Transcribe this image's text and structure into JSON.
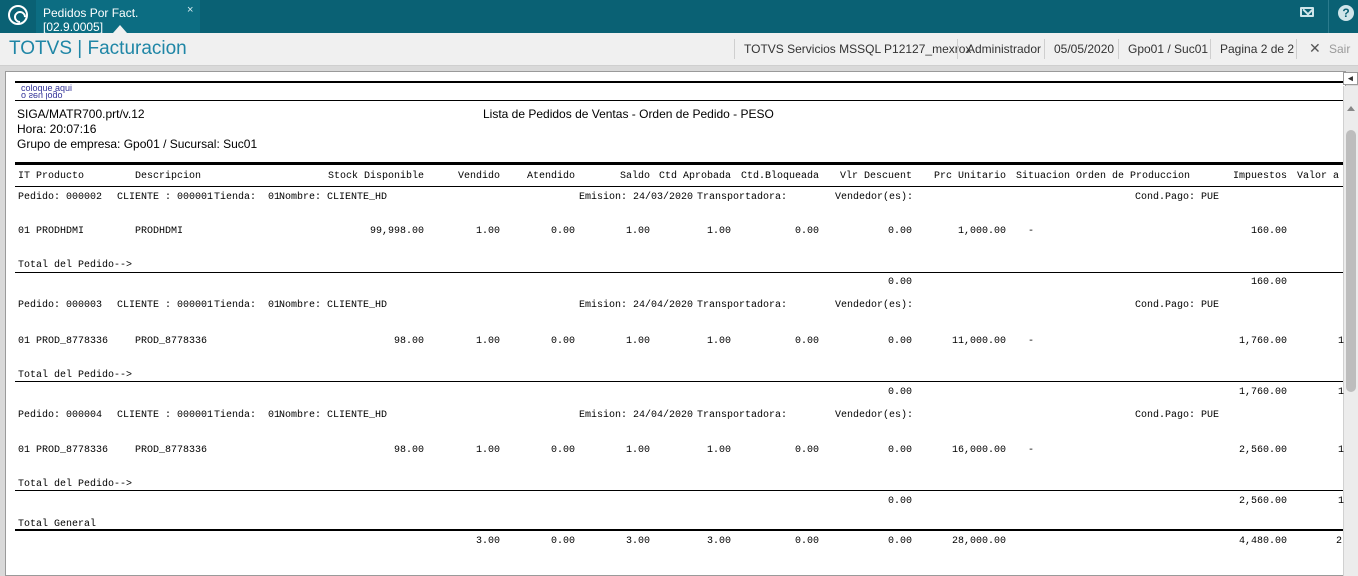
{
  "topbar": {
    "tab_title": "Pedidos Por Fact. [02.9.0005]",
    "tab_close": "×",
    "help": "?"
  },
  "titlebar": {
    "app_title": "TOTVS | Facturacion",
    "server": "TOTVS Servicios MSSQL P12127_mexrox",
    "user": "Administrador",
    "date": "05/05/2020",
    "branch": "Gpo01 / Suc01",
    "page": "Pagina 2 de 2",
    "exit_icon": "✕",
    "exit_label": "Sair"
  },
  "viewer": {
    "collapse": "◂",
    "logo_line1": "coloque aqui",
    "logo_line2": "o seu logo"
  },
  "report": {
    "program": "SIGA/MATR700.prt/v.12",
    "title": "Lista de Pedidos de Ventas  - Orden de Pedido - PESO",
    "time": "Hora: 20:07:16",
    "group": "Grupo de empresa: Gpo01 / Sucursal: Suc01",
    "columns": {
      "it_producto": "IT Producto",
      "descripcion": "Descripcion",
      "stock": "Stock Disponible",
      "vendido": "Vendido",
      "atendido": "Atendido",
      "saldo": "Saldo",
      "ctd_aprobada": "Ctd Aprobada",
      "ctd_bloqueada": "Ctd.Bloqueada",
      "vlr_descuent": "Vlr Descuent",
      "prc_unitario": "Prc Unitario",
      "situacion": "Situacion",
      "orden_produccion": "Orden de Produccion",
      "impuestos": "Impuestos",
      "valor": "Valor a"
    },
    "orders": [
      {
        "pedido": "Pedido: 000002",
        "cliente": "CLIENTE : 000001",
        "tienda": "Tienda:  01",
        "nombre": "Nombre: CLIENTE_HD",
        "emision": "Emision: 24/03/2020",
        "transportadora": "Transportadora:",
        "vendedor": "Vendedor(es):",
        "cond_pago": "Cond.Pago: PUE",
        "item": {
          "it_producto": "01 PRODHDMI",
          "descripcion": "PRODHDMI",
          "stock": "99,998.00",
          "vendido": "1.00",
          "atendido": "0.00",
          "saldo": "1.00",
          "ctd_aprobada": "1.00",
          "ctd_bloqueada": "0.00",
          "vlr_descuent": "0.00",
          "prc_unitario": "1,000.00",
          "situacion": "-",
          "impuestos": "160.00",
          "valor": ""
        },
        "total_label": "Total del Pedido-->",
        "total_descuent": "0.00",
        "total_impuestos": "160.00",
        "total_valor": ""
      },
      {
        "pedido": "Pedido: 000003",
        "cliente": "CLIENTE : 000001",
        "tienda": "Tienda:  01",
        "nombre": "Nombre: CLIENTE_HD",
        "emision": "Emision: 24/04/2020",
        "transportadora": "Transportadora:",
        "vendedor": "Vendedor(es):",
        "cond_pago": "Cond.Pago: PUE",
        "item": {
          "it_producto": "01 PROD_8778336",
          "descripcion": "PROD_8778336",
          "stock": "98.00",
          "vendido": "1.00",
          "atendido": "0.00",
          "saldo": "1.00",
          "ctd_aprobada": "1.00",
          "ctd_bloqueada": "0.00",
          "vlr_descuent": "0.00",
          "prc_unitario": "11,000.00",
          "situacion": "-",
          "impuestos": "1,760.00",
          "valor": "1"
        },
        "total_label": "Total del Pedido-->",
        "total_descuent": "0.00",
        "total_impuestos": "1,760.00",
        "total_valor": "1"
      },
      {
        "pedido": "Pedido: 000004",
        "cliente": "CLIENTE : 000001",
        "tienda": "Tienda:  01",
        "nombre": "Nombre: CLIENTE_HD",
        "emision": "Emision: 24/04/2020",
        "transportadora": "Transportadora:",
        "vendedor": "Vendedor(es):",
        "cond_pago": "Cond.Pago: PUE",
        "item": {
          "it_producto": "01 PROD_8778336",
          "descripcion": "PROD_8778336",
          "stock": "98.00",
          "vendido": "1.00",
          "atendido": "0.00",
          "saldo": "1.00",
          "ctd_aprobada": "1.00",
          "ctd_bloqueada": "0.00",
          "vlr_descuent": "0.00",
          "prc_unitario": "16,000.00",
          "situacion": "-",
          "impuestos": "2,560.00",
          "valor": "1"
        },
        "total_label": "Total del Pedido-->",
        "total_descuent": "0.00",
        "total_impuestos": "2,560.00",
        "total_valor": "1"
      }
    ],
    "grand_total": {
      "label": "Total General",
      "vendido": "3.00",
      "atendido": "0.00",
      "saldo": "3.00",
      "ctd_aprobada": "3.00",
      "ctd_bloqueada": "0.00",
      "vlr_descuent": "0.00",
      "prc_unitario": "28,000.00",
      "impuestos": "4,480.00",
      "valor": "2"
    }
  }
}
